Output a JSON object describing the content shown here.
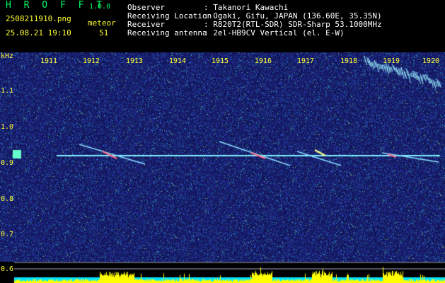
{
  "header": {
    "app_title": "H R O F F T",
    "app_version": "1.0.0",
    "file_name": "2508211910.png",
    "date_time": "25.08.21 19:10",
    "meteor_label": "meteor",
    "meteor_count": "51"
  },
  "info": [
    {
      "key": "Observer",
      "value": ": Takanori Kawachi"
    },
    {
      "key": "Receiving Location",
      "value": ": Ogaki, Gifu, JAPAN (136.60E, 35.35N)"
    },
    {
      "key": "Receiver",
      "value": ": R820T2(RTL-SDR) SDR-Sharp 53.1000MHz"
    },
    {
      "key": "Receiving antenna",
      "value": ": 2el-HB9CV Vertical (el. E-W)"
    }
  ],
  "spectrogram": {
    "unit_label": "kHz",
    "y_ticks": [
      "1.1",
      "1.0",
      "0.9",
      "0.8",
      "0.7",
      "0.6"
    ],
    "time_ticks": [
      "1911",
      "1912",
      "1913",
      "1914",
      "1915",
      "1916",
      "1917",
      "1918",
      "1919",
      "1920"
    ],
    "colors": {
      "background": "#1a1f6e",
      "carrier": "#7ff0ff",
      "axis_text": "#ffff33",
      "level_bar": "#ffff00",
      "level_base": "#00e5ff"
    }
  }
}
